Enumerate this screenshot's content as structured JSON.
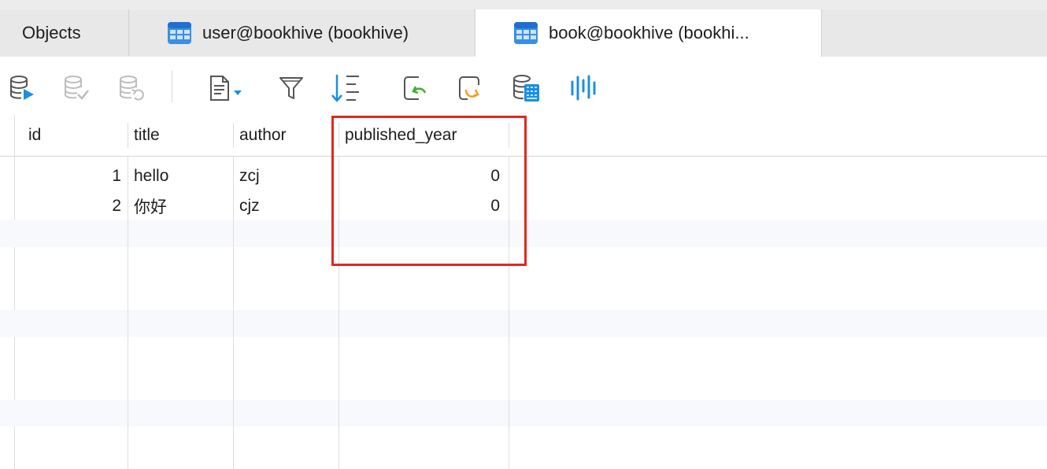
{
  "tabs": [
    {
      "label": "Objects"
    },
    {
      "label": "user@bookhive (bookhive)"
    },
    {
      "label": "book@bookhive (bookhi..."
    }
  ],
  "toolbar": {
    "items": [
      "run-query-icon",
      "commit-icon",
      "rollback-icon",
      "text-view-icon",
      "filter-icon",
      "sort-icon",
      "import-icon",
      "export-icon",
      "data-generator-icon",
      "chart-icon"
    ]
  },
  "table": {
    "columns": [
      "id",
      "title",
      "author",
      "published_year"
    ],
    "rows": [
      {
        "id": "1",
        "title": "hello",
        "author": "zcj",
        "published_year": "0"
      },
      {
        "id": "2",
        "title": "你好",
        "author": "cjz",
        "published_year": "0"
      }
    ]
  },
  "colors": {
    "highlight": "#e5271d",
    "accent_blue": "#1a8fe3",
    "import_green": "#3fae2a",
    "export_orange": "#f0a020"
  }
}
